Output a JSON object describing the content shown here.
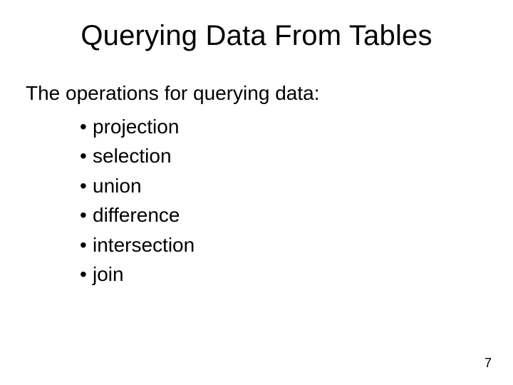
{
  "slide": {
    "title": "Querying Data From Tables",
    "intro": "The operations for querying data:",
    "bullets": [
      "projection",
      "selection",
      "union",
      "difference",
      "intersection",
      "join"
    ],
    "page_number": "7"
  }
}
